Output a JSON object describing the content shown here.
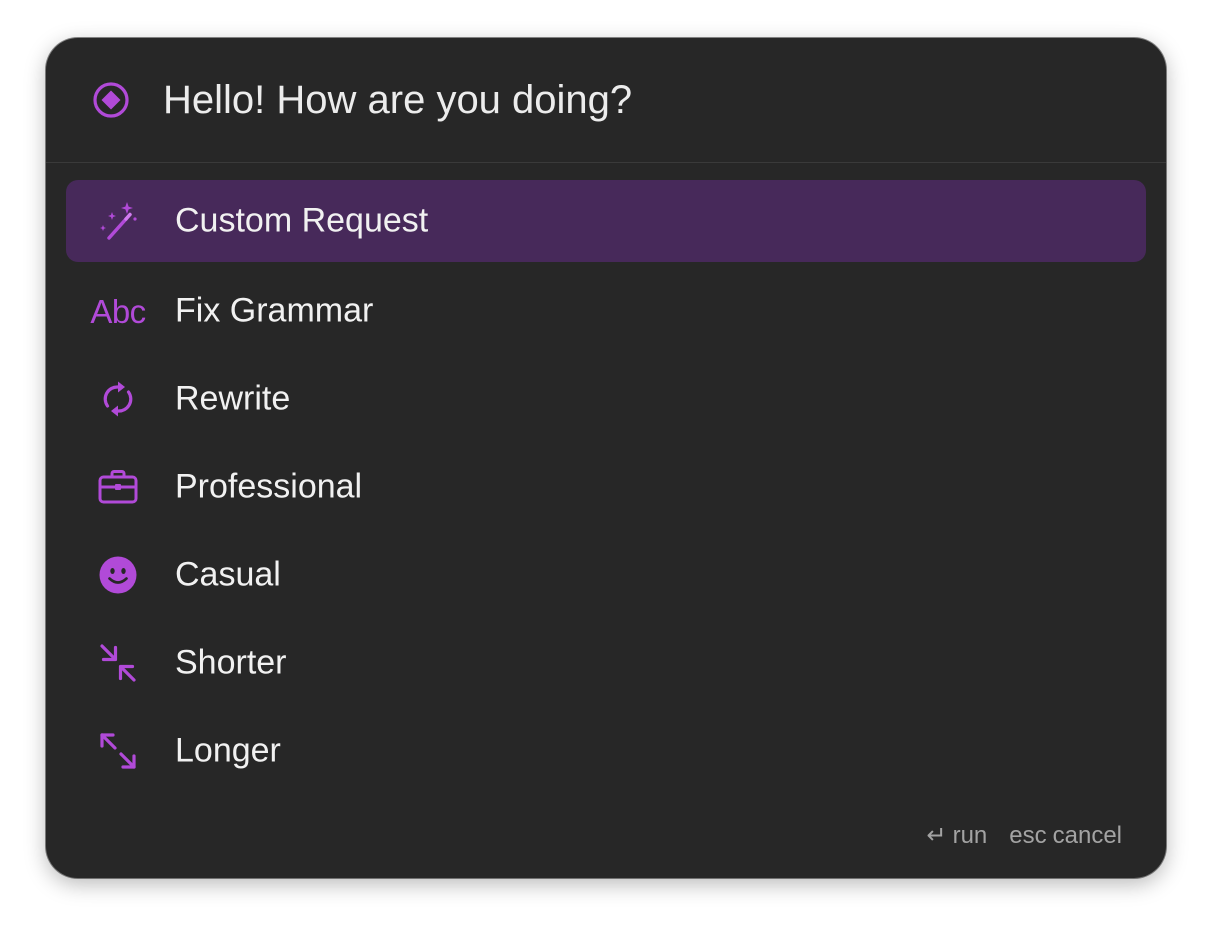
{
  "header": {
    "title": "Hello! How are you doing?",
    "icon": "ai-diamond-icon"
  },
  "actions": [
    {
      "label": "Custom Request",
      "icon": "magic-wand-icon",
      "selected": true
    },
    {
      "label": "Fix Grammar",
      "icon": "abc-text-icon",
      "icon_text": "Abc",
      "selected": false
    },
    {
      "label": "Rewrite",
      "icon": "refresh-icon",
      "selected": false
    },
    {
      "label": "Professional",
      "icon": "briefcase-icon",
      "selected": false
    },
    {
      "label": "Casual",
      "icon": "smiley-icon",
      "selected": false
    },
    {
      "label": "Shorter",
      "icon": "shrink-arrows-icon",
      "selected": false
    },
    {
      "label": "Longer",
      "icon": "expand-arrows-icon",
      "selected": false
    }
  ],
  "footer": {
    "run_key": "↵",
    "run_label": "run",
    "cancel_key": "esc",
    "cancel_label": "cancel"
  },
  "colors": {
    "accent": "#b14ad8",
    "panel_bg": "#272727",
    "selected_bg": "#47295a",
    "text": "#f1f1f1",
    "muted": "#a3a3a3"
  }
}
